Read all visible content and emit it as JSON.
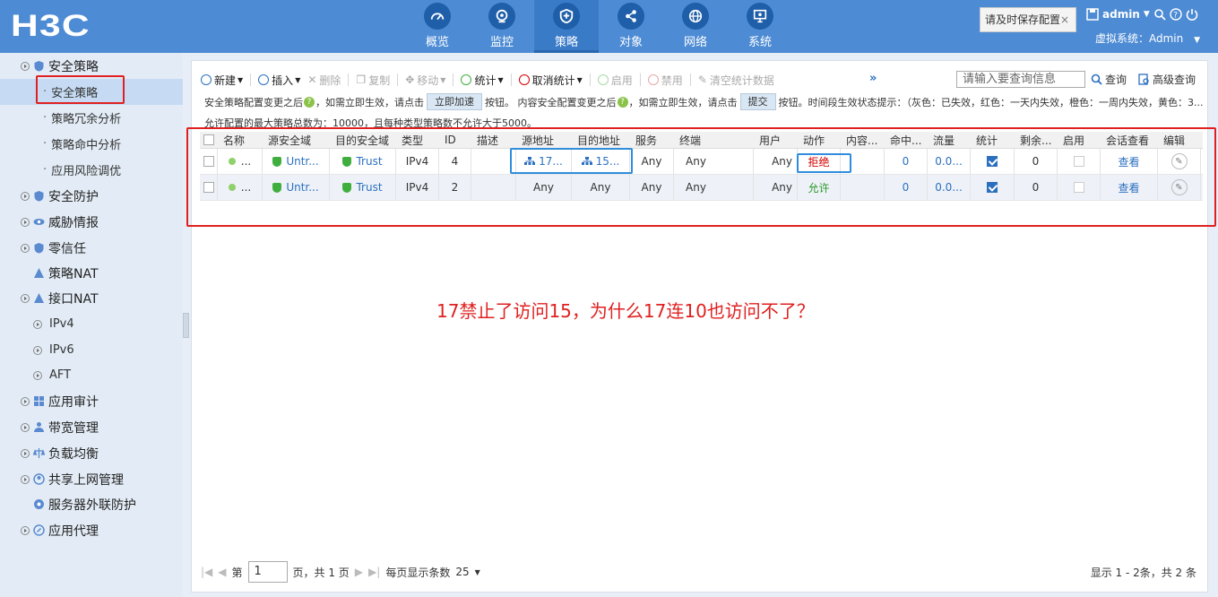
{
  "header": {
    "logo": "H3C",
    "nav": [
      {
        "label": "概览",
        "icon": "gauge-icon"
      },
      {
        "label": "监控",
        "icon": "monitor-icon"
      },
      {
        "label": "策略",
        "icon": "policy-shield-icon",
        "active": true
      },
      {
        "label": "对象",
        "icon": "share-icon"
      },
      {
        "label": "网络",
        "icon": "globe-icon"
      },
      {
        "label": "系统",
        "icon": "system-icon"
      }
    ],
    "save_tip": "请及时保存配置",
    "save_tip_close": "×",
    "user": "admin",
    "vsys": "虚拟系统：Admin"
  },
  "sidebar": {
    "items": [
      {
        "label": "安全策略",
        "type": "group"
      },
      {
        "label": "安全策略",
        "type": "sub",
        "active": true
      },
      {
        "label": "策略冗余分析",
        "type": "sub"
      },
      {
        "label": "策略命中分析",
        "type": "sub"
      },
      {
        "label": "应用风险调优",
        "type": "sub"
      },
      {
        "label": "安全防护",
        "type": "group"
      },
      {
        "label": "威胁情报",
        "type": "group"
      },
      {
        "label": "零信任",
        "type": "group"
      },
      {
        "label": "策略NAT",
        "type": "leaf"
      },
      {
        "label": "接口NAT",
        "type": "group"
      },
      {
        "label": "IPv4",
        "type": "sub2"
      },
      {
        "label": "IPv6",
        "type": "sub2"
      },
      {
        "label": "AFT",
        "type": "sub2"
      },
      {
        "label": "应用审计",
        "type": "group"
      },
      {
        "label": "带宽管理",
        "type": "group"
      },
      {
        "label": "负载均衡",
        "type": "group"
      },
      {
        "label": "共享上网管理",
        "type": "group"
      },
      {
        "label": "服务器外联防护",
        "type": "leaf"
      },
      {
        "label": "应用代理",
        "type": "group"
      }
    ]
  },
  "toolbar": {
    "new": "新建",
    "insert": "插入",
    "delete": "删除",
    "copy": "复制",
    "move": "移动",
    "stats": "统计",
    "cancel_stats": "取消统计",
    "enable": "启用",
    "disable": "禁用",
    "clear_stats": "清空统计数据",
    "more": "»",
    "search_placeholder": "请输入要查询信息",
    "query": "查询",
    "advanced_query": "高级查询"
  },
  "info": {
    "line1_a": "安全策略配置变更之后",
    "line1_b": "，如需立即生效，请点击",
    "btn_accelerate": "立即加速",
    "line1_c": "按钮。 内容安全配置变更之后",
    "line1_d": "，如需立即生效，请点击",
    "btn_submit": "提交",
    "line1_e": "按钮。时间段生效状态提示：（灰色：已失效，红色：一天内失效，橙色：一周内失效，黄色：3...",
    "line2": "允许配置的最大策略总数为：10000，且每种类型策略数不允许大于5000。"
  },
  "table": {
    "headers": [
      "名称",
      "源安全域",
      "目的安全域",
      "类型",
      "ID",
      "描述",
      "源地址",
      "目的地址",
      "服务",
      "终端",
      "用户",
      "动作",
      "内容...",
      "命中...",
      "流量",
      "统计",
      "剩余...",
      "启用",
      "会话查看",
      "编辑"
    ],
    "rows": [
      {
        "name": "...",
        "src_zone": "Untr...",
        "dst_zone": "Trust",
        "type": "IPv4",
        "id": "4",
        "desc": "",
        "src_addr": "17...",
        "dst_addr": "15...",
        "service": "Any",
        "terminal": "Any",
        "user": "Any",
        "action": "拒绝",
        "action_kind": "deny",
        "content": "",
        "hits": "0",
        "traffic": "0.0...",
        "stats": true,
        "remaining": "0",
        "enabled": false,
        "session": "查看"
      },
      {
        "name": "...",
        "src_zone": "Untr...",
        "dst_zone": "Trust",
        "type": "IPv4",
        "id": "2",
        "desc": "",
        "src_addr": "Any",
        "dst_addr": "Any",
        "service": "Any",
        "terminal": "Any",
        "user": "Any",
        "action": "允许",
        "action_kind": "allow",
        "content": "",
        "hits": "0",
        "traffic": "0.0...",
        "stats": true,
        "remaining": "0",
        "enabled": false,
        "session": "查看"
      }
    ]
  },
  "annotation": "17禁止了访问15，为什么17连10也访问不了？",
  "pager": {
    "page_label": "第",
    "page": "1",
    "page_total": "页，共 1 页",
    "per_page_label": "每页显示条数",
    "per_page": "25",
    "summary": "显示 1 - 2条，共 2 条"
  },
  "colors": {
    "header": "#4d8bd4",
    "accent": "#2b6fbf",
    "annotation": "#e02020",
    "highlight": "#2f8ddc"
  }
}
